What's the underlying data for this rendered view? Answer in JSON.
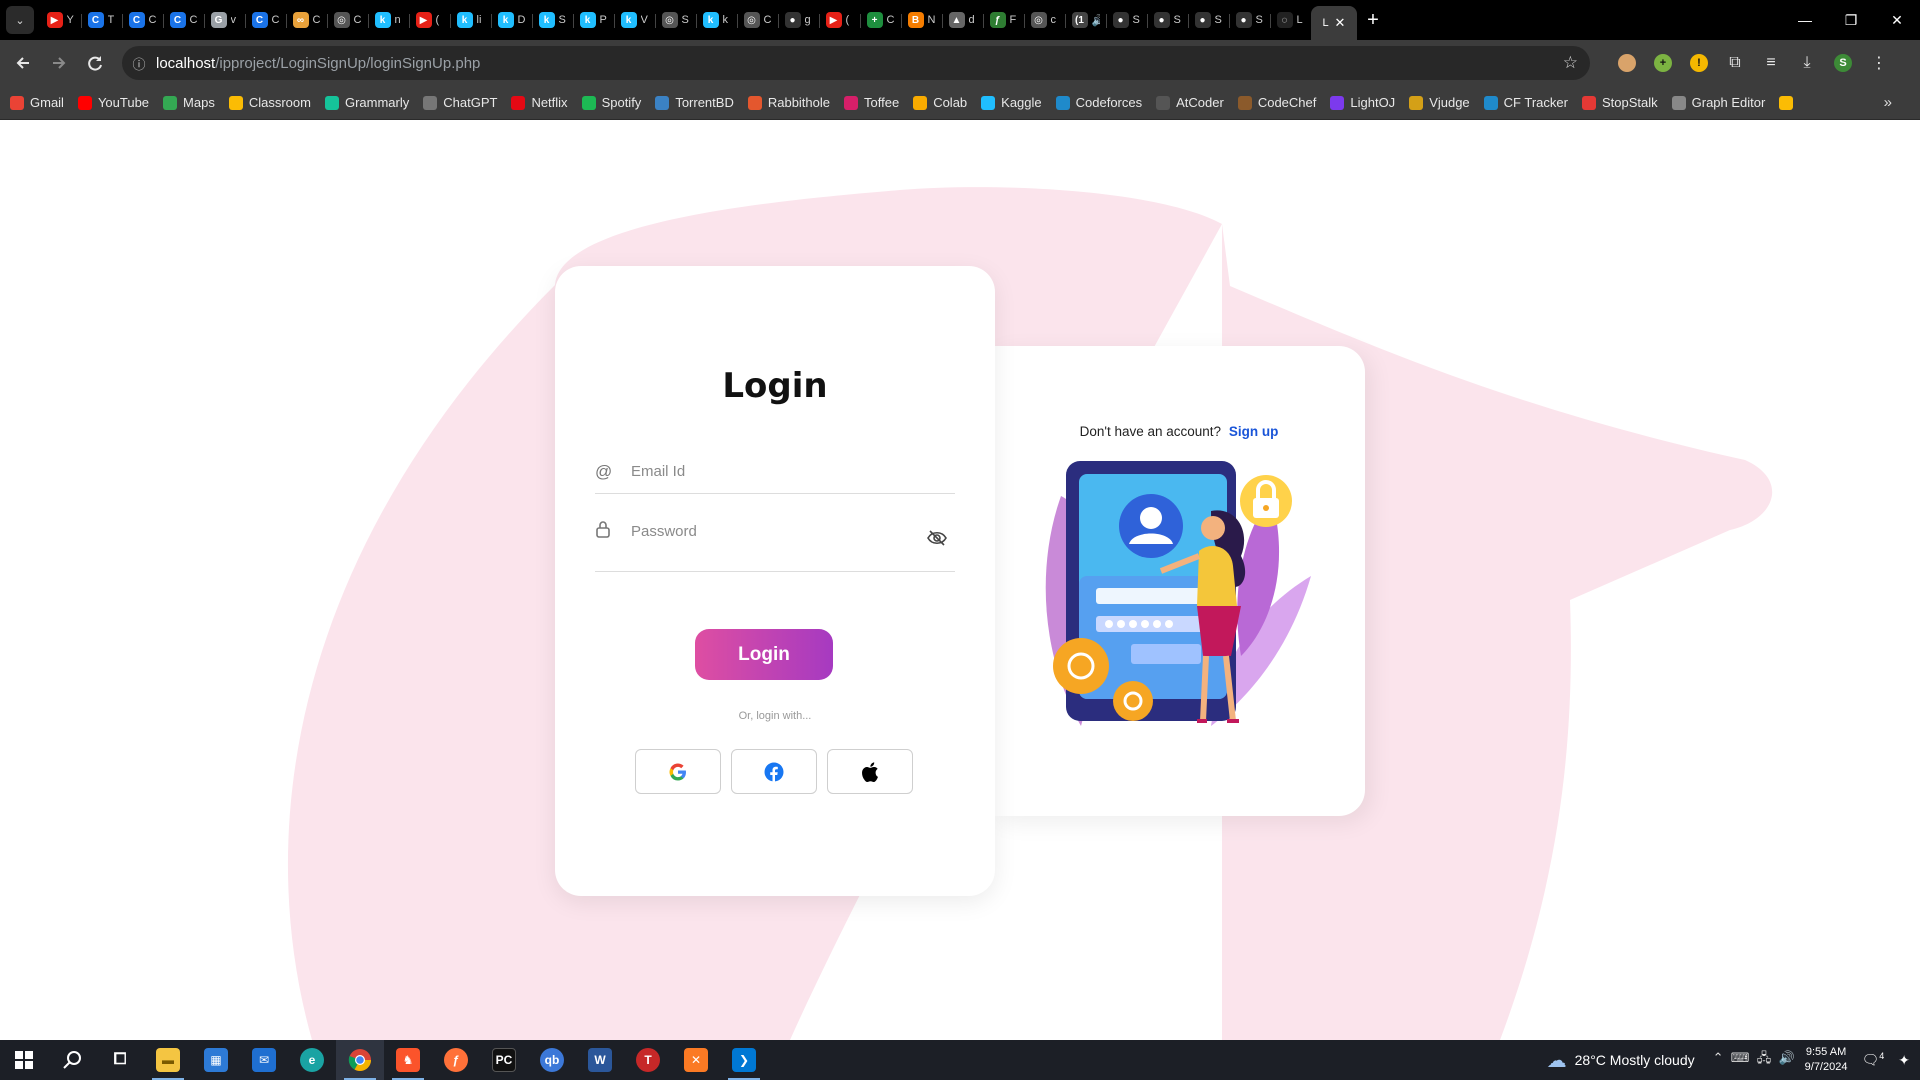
{
  "browser": {
    "tabs": [
      {
        "icon": "youtube-icon",
        "color": "#e62117",
        "letter": "▶",
        "title": "Y"
      },
      {
        "icon": "codeforces-c-icon",
        "color": "#1a73e8",
        "letter": "C",
        "title": "T"
      },
      {
        "icon": "codeforces-c-icon",
        "color": "#1a73e8",
        "letter": "C",
        "title": "C"
      },
      {
        "icon": "codeforces-c-icon",
        "color": "#1a73e8",
        "letter": "C",
        "title": "C"
      },
      {
        "icon": "globe-icon",
        "color": "#9aa0a6",
        "letter": "G",
        "title": "v"
      },
      {
        "icon": "codeforces-c-icon",
        "color": "#1a73e8",
        "letter": "C",
        "title": "C"
      },
      {
        "icon": "infinity-icon",
        "color": "#e8a13a",
        "letter": "∞",
        "title": "C"
      },
      {
        "icon": "chatgpt-icon",
        "color": "#555",
        "letter": "◎",
        "title": "C"
      },
      {
        "icon": "kaggle-icon",
        "color": "#20beff",
        "letter": "k",
        "title": "n"
      },
      {
        "icon": "youtube-icon",
        "color": "#e62117",
        "letter": "▶",
        "title": "("
      },
      {
        "icon": "kaggle-icon",
        "color": "#20beff",
        "letter": "k",
        "title": "li"
      },
      {
        "icon": "kaggle-icon",
        "color": "#20beff",
        "letter": "k",
        "title": "D"
      },
      {
        "icon": "kaggle-icon",
        "color": "#20beff",
        "letter": "k",
        "title": "S"
      },
      {
        "icon": "kaggle-icon",
        "color": "#20beff",
        "letter": "k",
        "title": "P"
      },
      {
        "icon": "kaggle-icon",
        "color": "#20beff",
        "letter": "k",
        "title": "V"
      },
      {
        "icon": "chatgpt-icon",
        "color": "#555",
        "letter": "◎",
        "title": "S"
      },
      {
        "icon": "kaggle-icon",
        "color": "#20beff",
        "letter": "k",
        "title": "k"
      },
      {
        "icon": "chatgpt-icon",
        "color": "#555",
        "letter": "◎",
        "title": "C"
      },
      {
        "icon": "github-icon",
        "color": "#333",
        "letter": "●",
        "title": "g"
      },
      {
        "icon": "youtube-icon",
        "color": "#e62117",
        "letter": "▶",
        "title": "("
      },
      {
        "icon": "sheets-icon",
        "color": "#1e8e3e",
        "letter": "+",
        "title": "C"
      },
      {
        "icon": "blogger-icon",
        "color": "#f57d00",
        "letter": "B",
        "title": "N"
      },
      {
        "icon": "drive-icon",
        "color": "#666",
        "letter": "▲",
        "title": "d"
      },
      {
        "icon": "leaf-icon",
        "color": "#2e7d32",
        "letter": "ƒ",
        "title": "F"
      },
      {
        "icon": "chatgpt-icon",
        "color": "#555",
        "letter": "◎",
        "title": "c"
      },
      {
        "icon": "audio-icon",
        "color": "#444",
        "letter": "(1",
        "title": "🔊"
      },
      {
        "icon": "github-icon",
        "color": "#333",
        "letter": "●",
        "title": "S"
      },
      {
        "icon": "github-icon",
        "color": "#333",
        "letter": "●",
        "title": "S"
      },
      {
        "icon": "github-icon",
        "color": "#333",
        "letter": "●",
        "title": "S"
      },
      {
        "icon": "github-icon",
        "color": "#333",
        "letter": "●",
        "title": "S"
      },
      {
        "icon": "loading-icon",
        "color": "#222",
        "letter": "◌",
        "title": "L"
      }
    ],
    "active_tab": {
      "title": "L",
      "close": "✕"
    },
    "new_tab": "+",
    "window_controls": {
      "minimize": "—",
      "restore": "❐",
      "close": "✕"
    },
    "url_host": "localhost",
    "url_path": "/ipproject/LoginSignUp/loginSignUp.php",
    "profile_letter": "S",
    "bookmarks": [
      {
        "label": "Gmail",
        "icon": "gmail-icon",
        "color": "#ea4335"
      },
      {
        "label": "YouTube",
        "icon": "youtube-icon",
        "color": "#ff0000"
      },
      {
        "label": "Maps",
        "icon": "maps-pin-icon",
        "color": "#34a853"
      },
      {
        "label": "Classroom",
        "icon": "classroom-icon",
        "color": "#fbbc04"
      },
      {
        "label": "Grammarly",
        "icon": "grammarly-icon",
        "color": "#15c39a"
      },
      {
        "label": "ChatGPT",
        "icon": "chatgpt-icon",
        "color": "#777"
      },
      {
        "label": "Netflix",
        "icon": "netflix-icon",
        "color": "#e50914"
      },
      {
        "label": "Spotify",
        "icon": "spotify-icon",
        "color": "#1db954"
      },
      {
        "label": "TorrentBD",
        "icon": "torrentbd-icon",
        "color": "#3b82c4"
      },
      {
        "label": "Rabbithole",
        "icon": "rabbithole-icon",
        "color": "#e4572e"
      },
      {
        "label": "Toffee",
        "icon": "toffee-icon",
        "color": "#d61f69"
      },
      {
        "label": "Colab",
        "icon": "colab-icon",
        "color": "#f9ab00"
      },
      {
        "label": "Kaggle",
        "icon": "kaggle-icon",
        "color": "#20beff"
      },
      {
        "label": "Codeforces",
        "icon": "codeforces-icon",
        "color": "#1f8acb"
      },
      {
        "label": "AtCoder",
        "icon": "atcoder-icon",
        "color": "#555"
      },
      {
        "label": "CodeChef",
        "icon": "codechef-icon",
        "color": "#8b5a2b"
      },
      {
        "label": "LightOJ",
        "icon": "lightoj-icon",
        "color": "#7c3aed"
      },
      {
        "label": "Vjudge",
        "icon": "vjudge-icon",
        "color": "#d4a017"
      },
      {
        "label": "CF Tracker",
        "icon": "cf-tracker-icon",
        "color": "#1f8acb"
      },
      {
        "label": "StopStalk",
        "icon": "stopstalk-icon",
        "color": "#e53935"
      },
      {
        "label": "Graph Editor",
        "icon": "graph-editor-icon",
        "color": "#888"
      },
      {
        "label": "",
        "icon": "google-drive-icon",
        "color": "#fbbc04"
      }
    ]
  },
  "login": {
    "title": "Login",
    "email_placeholder": "Email Id",
    "password_placeholder": "Password",
    "button": "Login",
    "or_text": "Or, login with...",
    "social": [
      "google-login",
      "facebook-login",
      "apple-login"
    ]
  },
  "signup": {
    "prompt": "Don't have an account?",
    "link": "Sign up"
  },
  "colors": {
    "accent_start": "#de4ea2",
    "accent_end": "#a63ac1",
    "background_blob": "#fbe4ec",
    "link": "#1a55d8"
  },
  "taskbar": {
    "apps": [
      {
        "name": "start",
        "icon": "windows-start-icon"
      },
      {
        "name": "search",
        "icon": "search-icon"
      },
      {
        "name": "task-view",
        "icon": "task-view-icon"
      },
      {
        "name": "file-explorer",
        "icon": "folder-icon"
      },
      {
        "name": "store",
        "icon": "store-icon"
      },
      {
        "name": "mail",
        "icon": "mail-icon"
      },
      {
        "name": "edge",
        "icon": "edge-icon"
      },
      {
        "name": "chrome",
        "icon": "chrome-icon"
      },
      {
        "name": "brave",
        "icon": "brave-icon"
      },
      {
        "name": "firefox",
        "icon": "firefox-icon"
      },
      {
        "name": "pycharm",
        "icon": "pycharm-icon"
      },
      {
        "name": "qbittorrent",
        "icon": "qbittorrent-icon"
      },
      {
        "name": "word",
        "icon": "word-icon"
      },
      {
        "name": "typora",
        "icon": "typora-icon"
      },
      {
        "name": "xampp",
        "icon": "xampp-icon"
      },
      {
        "name": "vscode",
        "icon": "vscode-icon"
      }
    ],
    "weather": "28°C  Mostly cloudy",
    "time": "9:55 AM",
    "date": "9/7/2024",
    "notifications": "4"
  }
}
